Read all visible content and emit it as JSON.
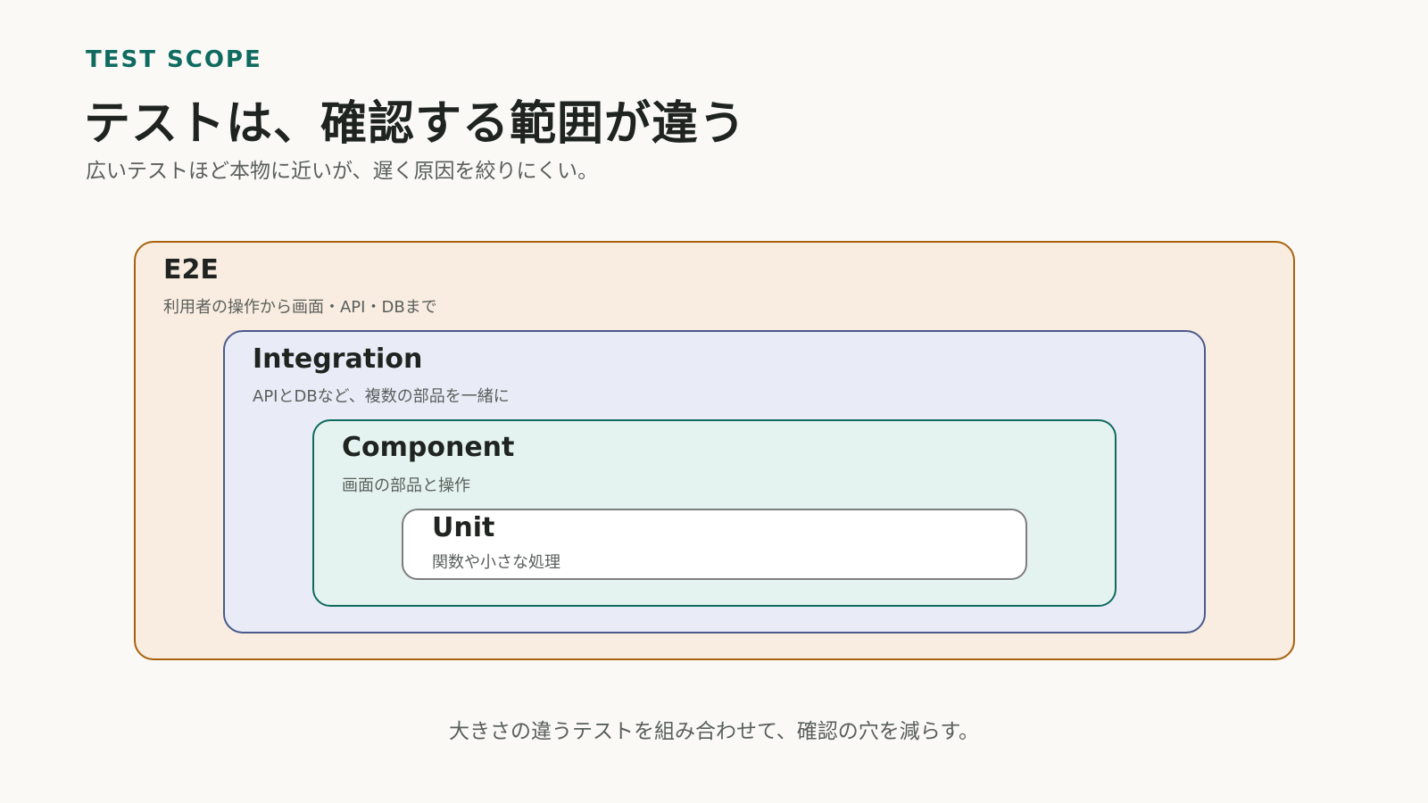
{
  "header": {
    "eyebrow": "TEST SCOPE",
    "title": "テストは、確認する範囲が違う",
    "subtitle": "広いテストほど本物に近いが、遅く原因を絞りにくい。"
  },
  "layers": [
    {
      "name": "E2E",
      "description": "利用者の操作から画面・API・DBまで",
      "background": "#f9ece0",
      "border": "#a8620e"
    },
    {
      "name": "Integration",
      "description": "APIとDBなど、複数の部品を一緒に",
      "background": "#e9ebf7",
      "border": "#4b5a8a"
    },
    {
      "name": "Component",
      "description": "画面の部品と操作",
      "background": "#e4f3ef",
      "border": "#0f6b60"
    },
    {
      "name": "Unit",
      "description": "関数や小さな処理",
      "background": "#ffffff",
      "border": "#7d7d7d"
    }
  ],
  "footer": {
    "caption": "大きさの違うテストを組み合わせて、確認の穴を減らす。"
  },
  "colors": {
    "accent": "#0f6b60",
    "background": "#faf9f6",
    "text": "#1f2421",
    "muted": "#5a5f5c"
  }
}
